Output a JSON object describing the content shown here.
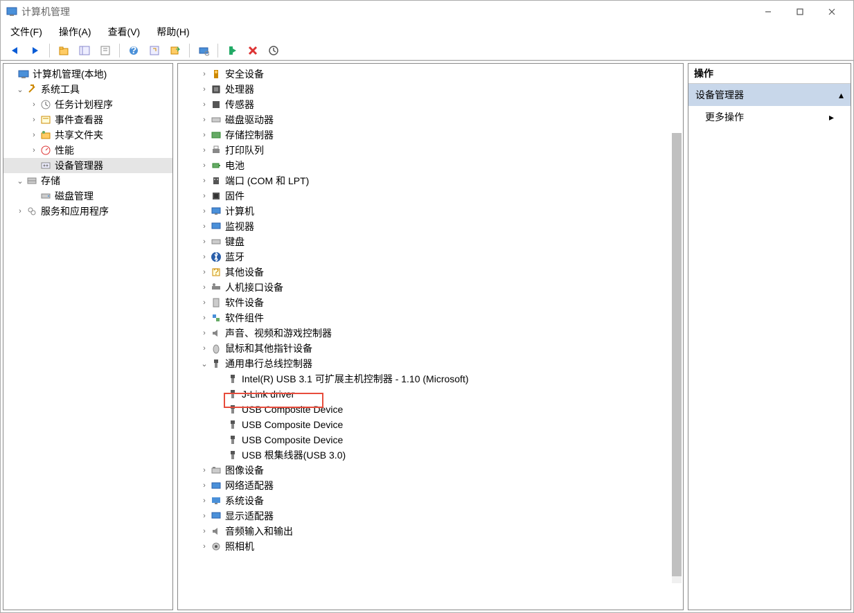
{
  "window": {
    "title": "计算机管理"
  },
  "menus": {
    "file": "文件(F)",
    "action": "操作(A)",
    "view": "查看(V)",
    "help": "帮助(H)"
  },
  "left_tree": {
    "root": "计算机管理(本地)",
    "system_tools": "系统工具",
    "task_scheduler": "任务计划程序",
    "event_viewer": "事件查看器",
    "shared_folders": "共享文件夹",
    "performance": "性能",
    "device_manager": "设备管理器",
    "storage": "存储",
    "disk_management": "磁盘管理",
    "services_apps": "服务和应用程序"
  },
  "center_tree": {
    "security_devices": "安全设备",
    "processors": "处理器",
    "sensors": "传感器",
    "disk_drives": "磁盘驱动器",
    "storage_controllers": "存储控制器",
    "print_queues": "打印队列",
    "batteries": "电池",
    "ports": "端口 (COM 和 LPT)",
    "firmware": "固件",
    "computer": "计算机",
    "monitors": "监视器",
    "keyboards": "键盘",
    "bluetooth": "蓝牙",
    "other_devices": "其他设备",
    "hid": "人机接口设备",
    "software_devices": "软件设备",
    "software_components": "软件组件",
    "sound": "声音、视频和游戏控制器",
    "mice": "鼠标和其他指针设备",
    "usb_controllers": "通用串行总线控制器",
    "usb_items": {
      "intel": "Intel(R) USB 3.1 可扩展主机控制器 - 1.10 (Microsoft)",
      "jlink": "J-Link driver",
      "comp1": "USB Composite Device",
      "comp2": "USB Composite Device",
      "comp3": "USB Composite Device",
      "hub": "USB 根集线器(USB 3.0)"
    },
    "imaging": "图像设备",
    "network": "网络适配器",
    "system_devices": "系统设备",
    "display": "显示适配器",
    "audio_io": "音频输入和输出",
    "cameras": "照相机"
  },
  "right_panel": {
    "header": "操作",
    "selected": "设备管理器",
    "more_actions": "更多操作"
  }
}
